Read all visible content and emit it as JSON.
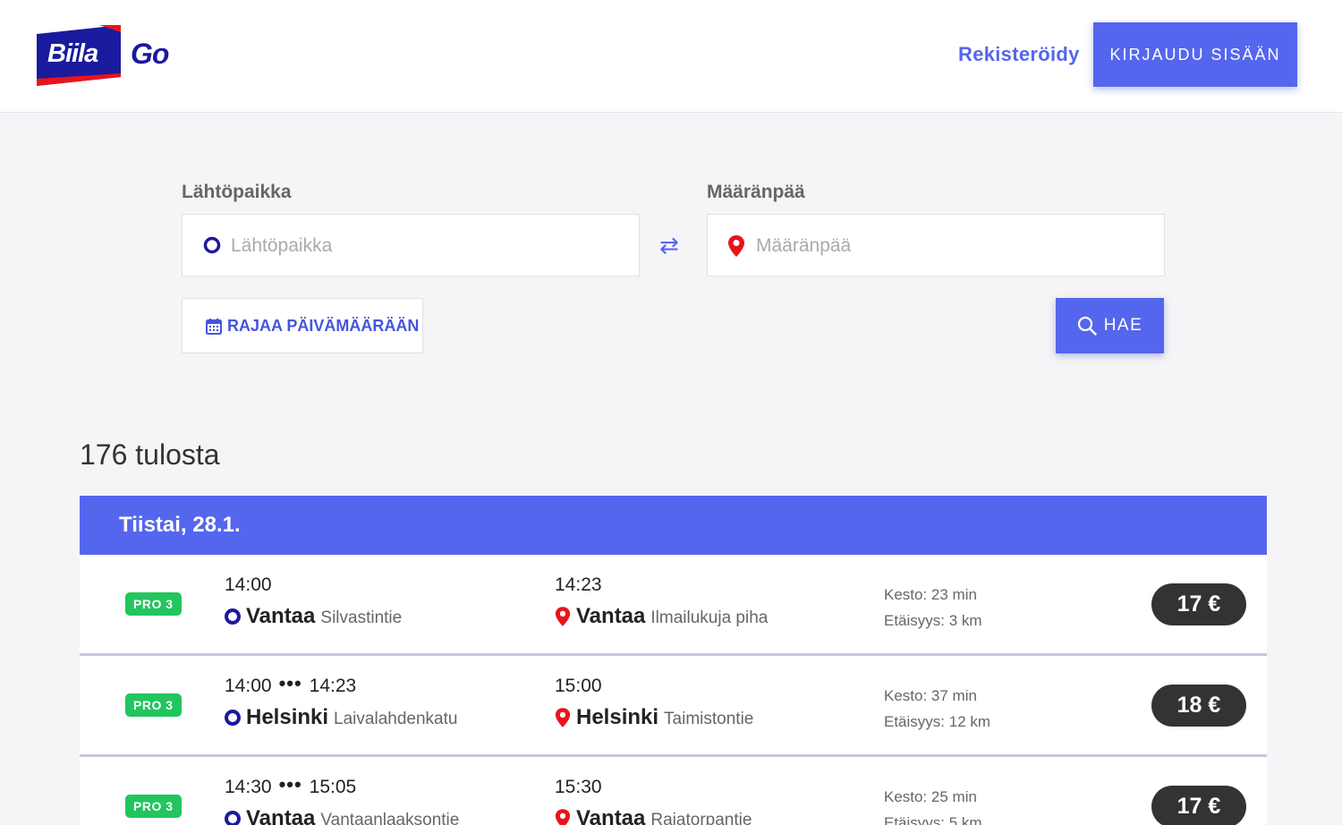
{
  "header": {
    "logo_text": "Biila",
    "logo_suffix": "Go",
    "register_label": "Rekisteröidy",
    "login_label": "KIRJAUDU SISÄÄN"
  },
  "search": {
    "from_label": "Lähtöpaikka",
    "from_placeholder": "Lähtöpaikka",
    "to_label": "Määränpää",
    "to_placeholder": "Määränpää",
    "swap_icon": "⇄",
    "date_button_label": "RAJAA PÄIVÄMÄÄRÄÄN",
    "search_button_label": "HAE"
  },
  "results": {
    "count_text": "176 tulosta",
    "day_label": "Tiistai, 28.1.",
    "trips": [
      {
        "badge": "PRO 3",
        "dep_time": "14:00",
        "dep_time_end": "",
        "dep_city": "Vantaa",
        "dep_street": "Silvastintie",
        "arr_time": "14:23",
        "arr_city": "Vantaa",
        "arr_street": "Ilmailukuja piha",
        "duration": "Kesto: 23 min",
        "distance": "Etäisyys: 3 km",
        "price": "17 €"
      },
      {
        "badge": "PRO 3",
        "dep_time": "14:00",
        "dep_time_end": "14:23",
        "dep_city": "Helsinki",
        "dep_street": "Laivalahdenkatu",
        "arr_time": "15:00",
        "arr_city": "Helsinki",
        "arr_street": "Taimistontie",
        "duration": "Kesto: 37 min",
        "distance": "Etäisyys: 12 km",
        "price": "18 €"
      },
      {
        "badge": "PRO 3",
        "dep_time": "14:30",
        "dep_time_end": "15:05",
        "dep_city": "Vantaa",
        "dep_street": "Vantaanlaaksontie",
        "arr_time": "15:30",
        "arr_city": "Vantaa",
        "arr_street": "Rajatorpantie",
        "duration": "Kesto: 25 min",
        "distance": "Etäisyys: 5 km",
        "price": "17 €"
      }
    ]
  },
  "colors": {
    "accent": "#5566ee",
    "brand_navy": "#1a1a9e",
    "brand_red": "#e8141c",
    "badge_green": "#22c55e",
    "price_bg": "#333333"
  }
}
